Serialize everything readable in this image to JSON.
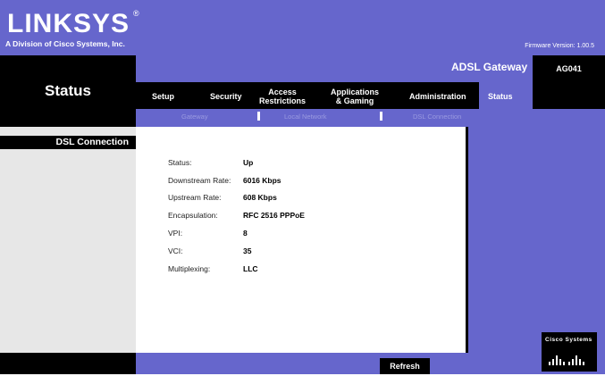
{
  "brand": {
    "logo": "LINKSYS",
    "registered": "®",
    "tagline": "A Division of Cisco Systems, Inc.",
    "firmware": "Firmware Version: 1.00.5"
  },
  "product": {
    "name": "ADSL Gateway",
    "model": "AG041"
  },
  "page_title": "Status",
  "tabs": [
    {
      "label": "Setup"
    },
    {
      "label": "Security"
    },
    {
      "label": "Access\nRestrictions"
    },
    {
      "label": "Applications\n& Gaming"
    },
    {
      "label": "Administration"
    },
    {
      "label": "Status",
      "active": true
    }
  ],
  "subtabs": [
    {
      "label": "Gateway"
    },
    {
      "label": "Local Network"
    },
    {
      "label": "DSL Connection",
      "active": true
    }
  ],
  "section_label": "DSL Connection",
  "fields": [
    {
      "label": "Status:",
      "value": "Up"
    },
    {
      "label": "Downstream Rate:",
      "value": "6016 Kbps"
    },
    {
      "label": "Upstream Rate:",
      "value": "608 Kbps"
    },
    {
      "label": "Encapsulation:",
      "value": "RFC 2516 PPPoE"
    },
    {
      "label": "VPI:",
      "value": "8"
    },
    {
      "label": "VCI:",
      "value": "35"
    },
    {
      "label": "Multiplexing:",
      "value": "LLC"
    }
  ],
  "buttons": {
    "refresh": "Refresh"
  },
  "footer_logo": "Cisco Systems",
  "colors": {
    "accent": "#6666cc",
    "dark": "#000000",
    "panel": "#e7e7e7"
  }
}
